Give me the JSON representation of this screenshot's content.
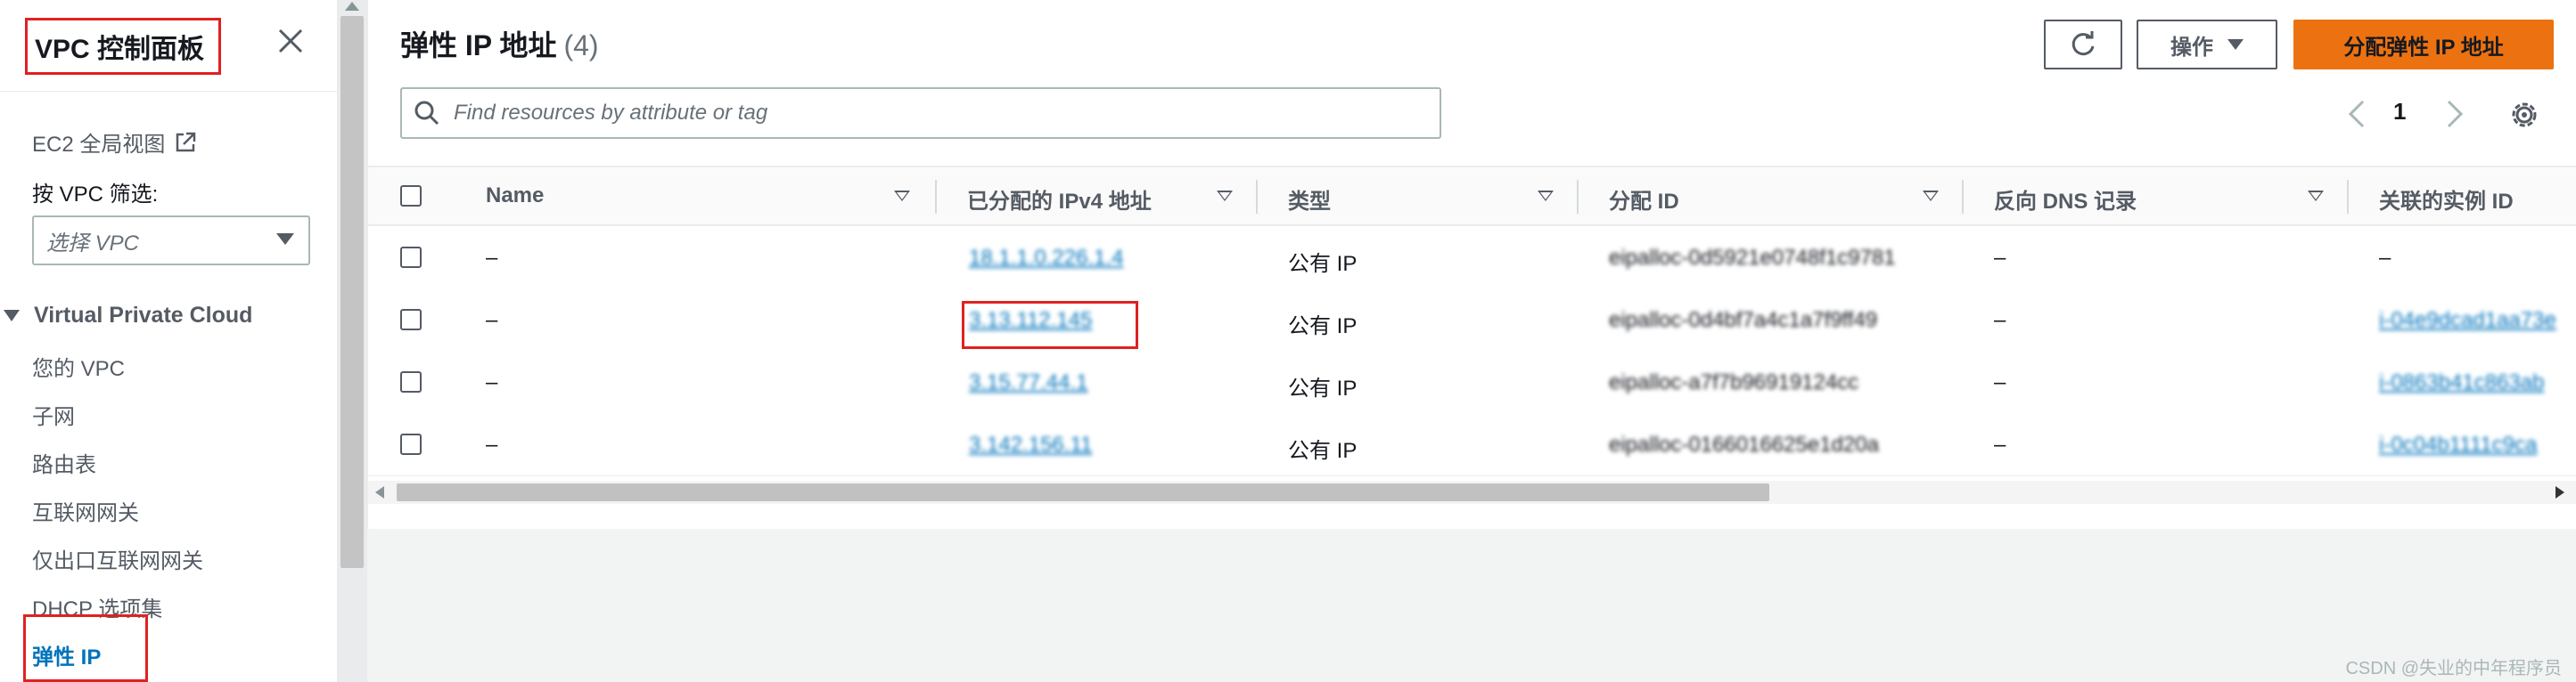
{
  "sidebar": {
    "title": "VPC 控制面板",
    "ec2_global_view": "EC2 全局视图",
    "filter_label": "按 VPC 筛选:",
    "filter_placeholder": "选择 VPC",
    "section": "Virtual Private Cloud",
    "nav": [
      "您的 VPC",
      "子网",
      "路由表",
      "互联网网关",
      "仅出口互联网网关",
      "DHCP 选项集",
      "弹性 IP"
    ]
  },
  "header": {
    "title": "弹性 IP 地址",
    "count": "(4)",
    "actions_label": "操作",
    "allocate_label": "分配弹性 IP 地址"
  },
  "search": {
    "placeholder": "Find resources by attribute or tag"
  },
  "pagination": {
    "page": "1"
  },
  "table": {
    "columns": [
      "Name",
      "已分配的 IPv4 地址",
      "类型",
      "分配 ID",
      "反向 DNS 记录",
      "关联的实例 ID"
    ],
    "rows": [
      {
        "name": "–",
        "ip": "18.1.1.0.226.1.4",
        "type": "公有 IP",
        "alloc_id": "eipalloc-0d5921e0748f1c9781",
        "dns": "–",
        "instance": "–"
      },
      {
        "name": "–",
        "ip": "3.13.112.145",
        "type": "公有 IP",
        "alloc_id": "eipalloc-0d4bf7a4c1a7f9ff49",
        "dns": "–",
        "instance": "i-04e9dcad1aa73e"
      },
      {
        "name": "–",
        "ip": "3.15.77.44.1",
        "type": "公有 IP",
        "alloc_id": "eipalloc-a7f7b96919124cc",
        "dns": "–",
        "instance": "i-0863b41c863ab"
      },
      {
        "name": "–",
        "ip": "3.142.156.11",
        "type": "公有 IP",
        "alloc_id": "eipalloc-0166016625e1d20a",
        "dns": "–",
        "instance": "i-0c04b1111c9ca"
      }
    ]
  },
  "watermark": "CSDN @失业的中年程序员",
  "colors": {
    "accent": "#ec7211",
    "link": "#0073bb",
    "highlight": "#e02121"
  }
}
